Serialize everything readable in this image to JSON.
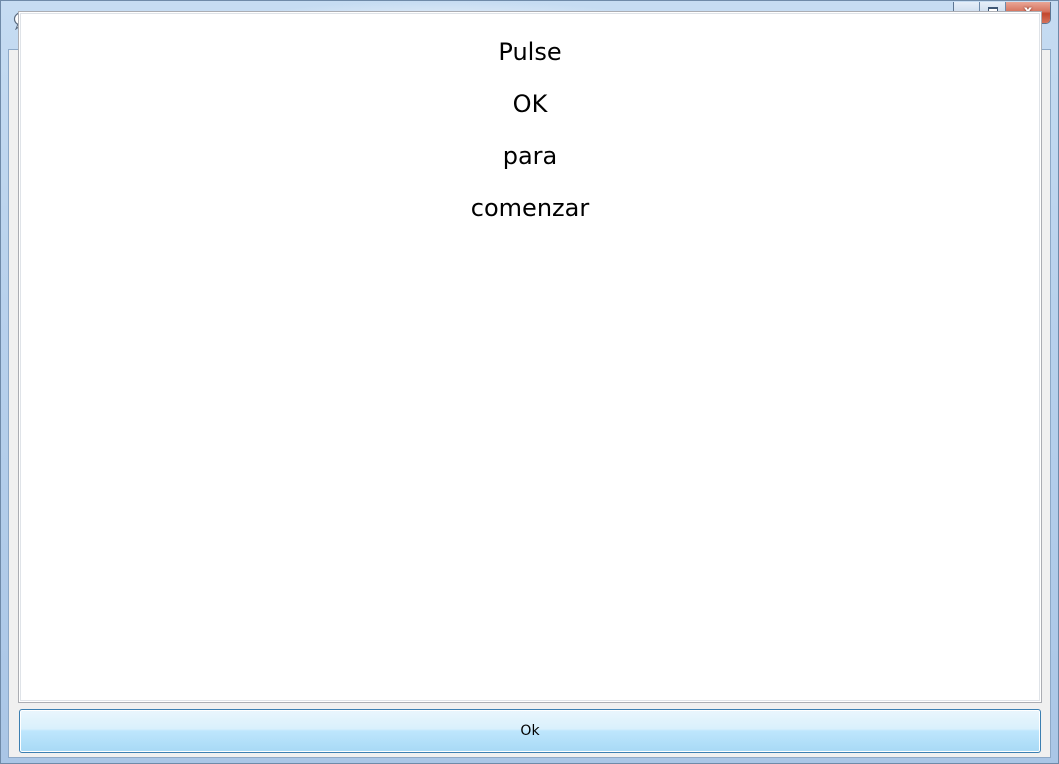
{
  "window": {
    "icon": "info-balloon-icon",
    "title": "",
    "controls": {
      "minimize_icon": "minimize-icon",
      "maximize_icon": "maximize-icon",
      "close_glyph": "x"
    }
  },
  "message": {
    "lines": [
      "Pulse",
      "OK",
      "para",
      "comenzar"
    ]
  },
  "ok_button": {
    "label": "Ok"
  },
  "colors": {
    "titlebar": "#b8d1ec",
    "close_button": "#c2472c",
    "button_face": "#bee6fd",
    "button_border": "#3c7fb1"
  }
}
